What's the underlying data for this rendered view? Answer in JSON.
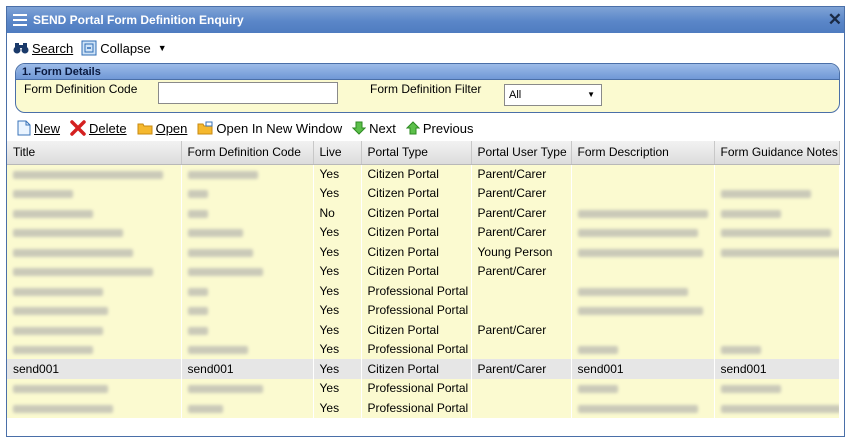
{
  "window": {
    "title": "SEND Portal Form Definition Enquiry",
    "close_glyph": "✕"
  },
  "toolbar": {
    "search_label": "Search",
    "collapse_label": "Collapse",
    "collapse_caret": "▼"
  },
  "form_details": {
    "section_title": "1. Form Details",
    "code_label": "Form Definition Code",
    "code_value": "",
    "filter_label": "Form Definition Filter",
    "filter_selected": "All",
    "filter_caret": "▼"
  },
  "actions": {
    "new_label": "New",
    "delete_label": "Delete",
    "open_label": "Open",
    "open_new_window_label": "Open In New Window",
    "next_label": "Next",
    "previous_label": "Previous"
  },
  "grid": {
    "columns": [
      "Title",
      "Form Definition Code",
      "Live",
      "Portal Type",
      "Portal User Type",
      "Form Description",
      "Form Guidance Notes"
    ],
    "rows": [
      [
        "",
        "",
        "Yes",
        "Citizen Portal",
        "Parent/Carer",
        "",
        ""
      ],
      [
        "",
        "",
        "Yes",
        "Citizen Portal",
        "Parent/Carer",
        "",
        ""
      ],
      [
        "",
        "",
        "No",
        "Citizen Portal",
        "Parent/Carer",
        "",
        ""
      ],
      [
        "",
        "",
        "Yes",
        "Citizen Portal",
        "Parent/Carer",
        "",
        ""
      ],
      [
        "",
        "",
        "Yes",
        "Citizen Portal",
        "Young Person",
        "",
        ""
      ],
      [
        "",
        "",
        "Yes",
        "Citizen Portal",
        "Parent/Carer",
        "",
        ""
      ],
      [
        "",
        "",
        "Yes",
        "Professional Portal",
        "",
        "",
        ""
      ],
      [
        "",
        "",
        "Yes",
        "Professional Portal",
        "",
        "",
        ""
      ],
      [
        "",
        "",
        "Yes",
        "Citizen Portal",
        "Parent/Carer",
        "",
        ""
      ],
      [
        "",
        "",
        "Yes",
        "Professional Portal",
        "",
        "",
        ""
      ],
      [
        "send001",
        "send001",
        "Yes",
        "Citizen Portal",
        "Parent/Carer",
        "send001",
        "send001"
      ],
      [
        "",
        "",
        "Yes",
        "Professional Portal",
        "",
        "",
        ""
      ],
      [
        "",
        "",
        "Yes",
        "Professional Portal",
        "",
        "",
        ""
      ]
    ],
    "selected_row_index": 10
  },
  "colors": {
    "title_bar": "#5a86c8",
    "panel_bg": "#fbfad0",
    "grid_bg": "#fbfad0",
    "selected_row": "#e6e6e6"
  }
}
